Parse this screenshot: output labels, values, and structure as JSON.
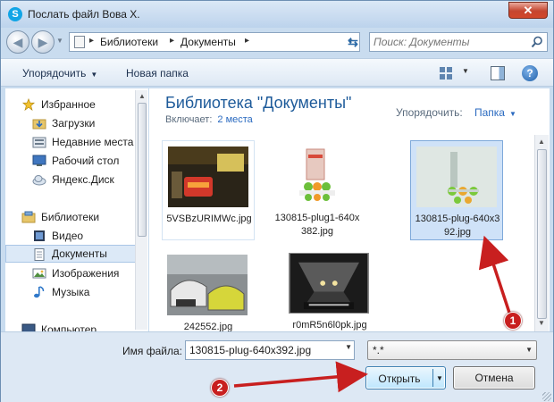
{
  "window": {
    "title": "Послать файл Вова Х.",
    "close_glyph": "✕",
    "app_icon_letter": "S"
  },
  "address": {
    "crumbs": [
      "Библиотеки",
      "Документы"
    ],
    "sep": "▸"
  },
  "search": {
    "placeholder": "Поиск: Документы"
  },
  "toolbar": {
    "organize_label": "Упорядочить",
    "new_folder_label": "Новая папка"
  },
  "nav": {
    "items": [
      {
        "label": "Избранное",
        "icon": "star-icon"
      },
      {
        "label": "Загрузки",
        "icon": "downloads-folder-icon"
      },
      {
        "label": "Недавние места",
        "icon": "recent-places-icon"
      },
      {
        "label": "Рабочий стол",
        "icon": "desktop-icon"
      },
      {
        "label": "Яндекс.Диск",
        "icon": "cloud-icon"
      },
      {
        "label": "Библиотеки",
        "icon": "libraries-icon"
      },
      {
        "label": "Видео",
        "icon": "video-icon"
      },
      {
        "label": "Документы",
        "icon": "documents-icon"
      },
      {
        "label": "Изображения",
        "icon": "pictures-icon"
      },
      {
        "label": "Музыка",
        "icon": "music-icon"
      },
      {
        "label": "Компьютер",
        "icon": "computer-icon"
      }
    ]
  },
  "library": {
    "title": "Библиотека \"Документы\"",
    "includes_label": "Включает:",
    "places": "2 места",
    "arrange_label": "Упорядочить:",
    "arrange_value": "Папка"
  },
  "files": [
    {
      "name": "5VSBzURIMWc.jpg",
      "selected": false,
      "thumb": "car-taillight"
    },
    {
      "name": "130815-plug1-640x382.jpg",
      "selected": false,
      "thumb": "plug-package"
    },
    {
      "name": "130815-plug-640x392.jpg",
      "selected": true,
      "thumb": "plug-wall"
    },
    {
      "name": "242552.jpg",
      "selected": false,
      "thumb": "crashed-cars"
    },
    {
      "name": "r0mR5n6l0pk.jpg",
      "selected": false,
      "thumb": "tunnel-night"
    }
  ],
  "bottom": {
    "filename_label": "Имя файла:",
    "filename_value": "130815-plug-640x392.jpg",
    "filetype_value": "*.*",
    "open_label": "Открыть",
    "cancel_label": "Отмена"
  },
  "annotations": {
    "badge1": "1",
    "badge2": "2",
    "color": "#c81f1f"
  }
}
